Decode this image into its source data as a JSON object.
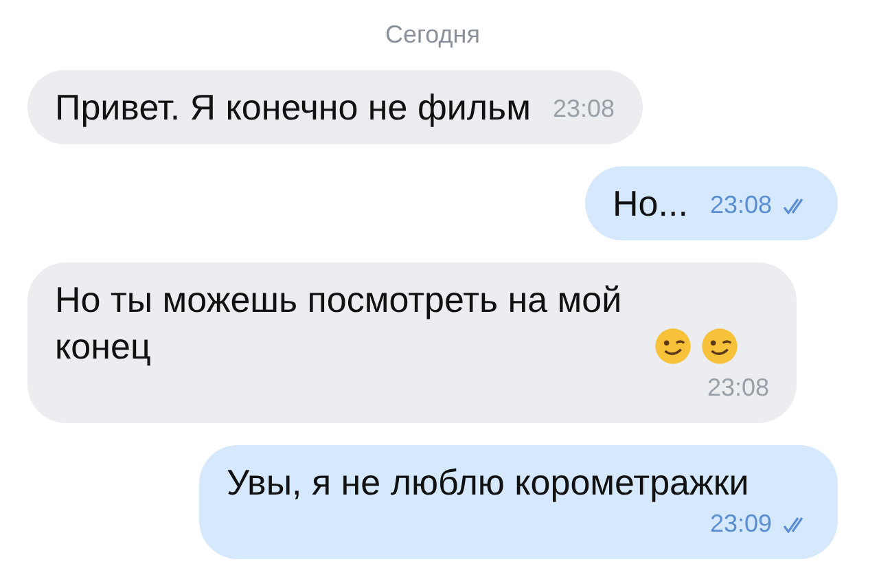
{
  "date_separator": "Сегодня",
  "messages": [
    {
      "kind": "incoming",
      "text": "Привет. Я конечно не фильм",
      "time": "23:08",
      "read": false,
      "emoji_after": false
    },
    {
      "kind": "outgoing",
      "text": "Но...",
      "time": "23:08",
      "read": true,
      "emoji_after": false
    },
    {
      "kind": "incoming",
      "text": "Но ты можешь посмотреть на мой конец",
      "time": "23:08",
      "read": false,
      "emoji_after": true
    },
    {
      "kind": "outgoing",
      "text": "Увы, я не люблю корометражки",
      "time": "23:09",
      "read": true,
      "emoji_after": false
    }
  ]
}
